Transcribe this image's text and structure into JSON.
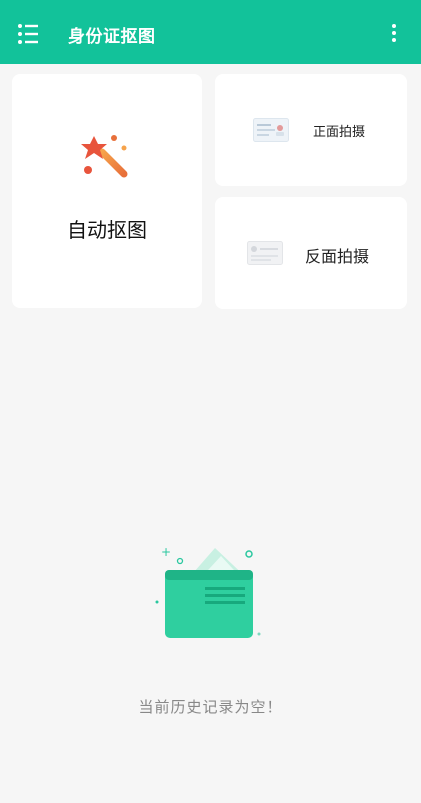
{
  "appbar": {
    "title": "身份证抠图",
    "menu_icon": "menu-list-icon",
    "more_icon": "more-vertical-icon"
  },
  "cards": {
    "auto": {
      "label": "自动抠图",
      "icon": "magic-wand-icon"
    },
    "front": {
      "label": "正面拍摄",
      "icon": "id-card-front-icon"
    },
    "back": {
      "label": "反面拍摄",
      "icon": "id-card-back-icon"
    }
  },
  "empty_state": {
    "text": "当前历史记录为空！",
    "icon": "empty-wallet-icon"
  },
  "colors": {
    "accent": "#12c29a",
    "background": "#f6f6f6",
    "card": "#ffffff"
  }
}
